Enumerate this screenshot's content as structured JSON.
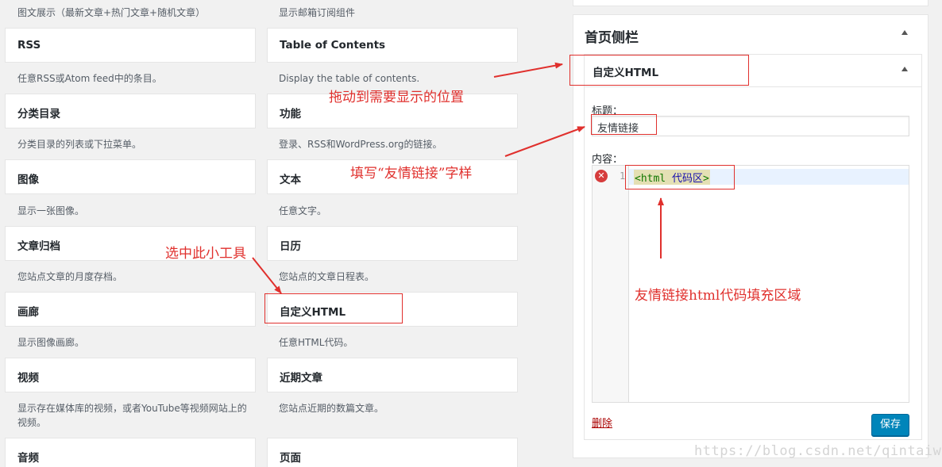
{
  "available_widgets": {
    "top_descriptions": {
      "left": "图文展示（最新文章+热门文章+随机文章）",
      "right": "显示邮箱订阅组件"
    },
    "items": [
      {
        "name": "RSS",
        "desc": "任意RSS或Atom feed中的条目。"
      },
      {
        "name": "Table of Contents",
        "desc": "Display the table of contents."
      },
      {
        "name": "分类目录",
        "desc": "分类目录的列表或下拉菜单。"
      },
      {
        "name": "功能",
        "desc": "登录、RSS和WordPress.org的链接。"
      },
      {
        "name": "图像",
        "desc": "显示一张图像。"
      },
      {
        "name": "文本",
        "desc": "任意文字。"
      },
      {
        "name": "文章归档",
        "desc": "您站点文章的月度存档。"
      },
      {
        "name": "日历",
        "desc": "您站点的文章日程表。"
      },
      {
        "name": "画廊",
        "desc": "显示图像画廊。"
      },
      {
        "name": "自定义HTML",
        "desc": "任意HTML代码。"
      },
      {
        "name": "视频",
        "desc": "显示存在媒体库的视频，或者YouTube等视频网站上的视频。"
      },
      {
        "name": "近期文章",
        "desc": "您站点近期的数篇文章。"
      },
      {
        "name": "音频",
        "desc": ""
      },
      {
        "name": "页面",
        "desc": ""
      }
    ]
  },
  "sidebar": {
    "title": "首页侧栏",
    "widget": {
      "title": "自定义HTML",
      "title_label": "标题：",
      "title_value": "友情链接",
      "content_label": "内容：",
      "line_number": "1",
      "code_tag_open": "<html ",
      "code_text": "代码区",
      "code_tag_close": ">",
      "error_icon": "error-icon",
      "delete_label": "删除",
      "save_label": "保存"
    }
  },
  "annotations": {
    "drag": "拖动到需要显示的位置",
    "fill_title": "填写“友情链接”字样",
    "select": "选中此小工具",
    "code_area": "友情链接html代码填充区域"
  },
  "watermark": "https://blog.csdn.net/qintaiwu",
  "colors": {
    "annotation": "#e0302d",
    "save_button": "#0085ba",
    "delete_link": "#a00"
  }
}
